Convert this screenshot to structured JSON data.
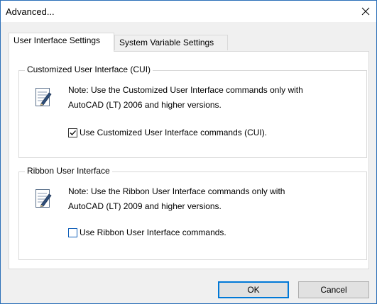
{
  "window": {
    "title": "Advanced...",
    "close_glyph": "✕"
  },
  "tabs": [
    {
      "label": "User Interface Settings",
      "active": true
    },
    {
      "label": "System Variable Settings",
      "active": false
    }
  ],
  "groups": [
    {
      "title": "Customized User Interface (CUI)",
      "icon": "note-icon",
      "note_line1": "Note: Use the Customized User Interface commands only with",
      "note_line2": "AutoCAD (LT) 2006 and higher versions.",
      "checkbox_label": "Use Customized User Interface commands (CUI).",
      "checked": true
    },
    {
      "title": "Ribbon User Interface",
      "icon": "note-icon",
      "note_line1": "Note: Use the Ribbon User Interface commands only with",
      "note_line2": "AutoCAD (LT) 2009 and higher versions.",
      "checkbox_label": "Use Ribbon User Interface commands.",
      "checked": false
    }
  ],
  "buttons": {
    "ok_label": "OK",
    "cancel_label": "Cancel"
  },
  "colors": {
    "window_border": "#2b6fb8",
    "default_button_border": "#0078d7",
    "checkbox_focus": "#0f5eb8"
  }
}
